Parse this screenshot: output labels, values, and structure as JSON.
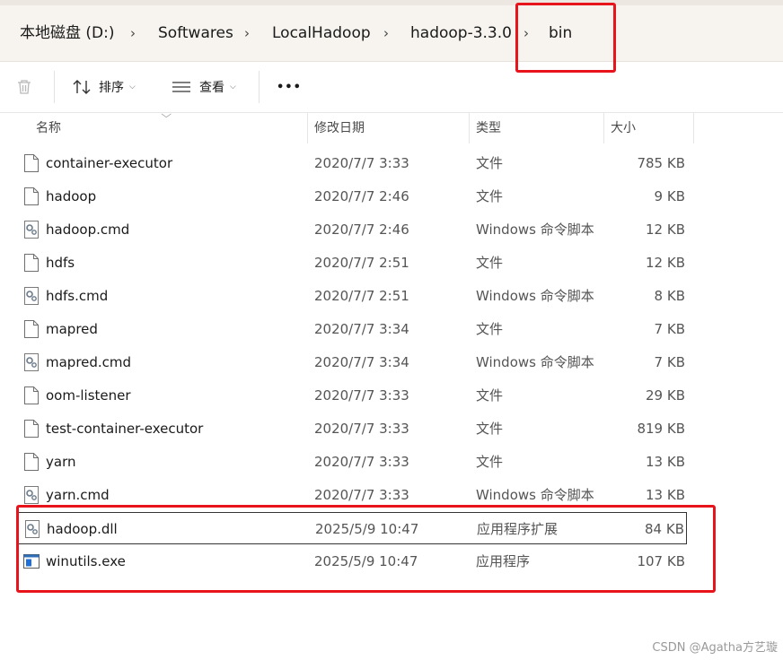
{
  "breadcrumb": {
    "items": [
      "本地磁盘 (D:)",
      "Softwares",
      "LocalHadoop",
      "hadoop-3.3.0",
      "bin"
    ],
    "separator": "›"
  },
  "toolbar": {
    "delete_icon": "trash-icon",
    "sort_label": "排序",
    "view_label": "查看",
    "more_label": "•••"
  },
  "columns": {
    "name": "名称",
    "date": "修改日期",
    "type": "类型",
    "size": "大小"
  },
  "files": [
    {
      "name": "container-executor",
      "date": "2020/7/7 3:33",
      "type": "文件",
      "size": "785 KB",
      "icon": "file-icon"
    },
    {
      "name": "hadoop",
      "date": "2020/7/7 2:46",
      "type": "文件",
      "size": "9 KB",
      "icon": "file-icon"
    },
    {
      "name": "hadoop.cmd",
      "date": "2020/7/7 2:46",
      "type": "Windows 命令脚本",
      "size": "12 KB",
      "icon": "gear-file-icon"
    },
    {
      "name": "hdfs",
      "date": "2020/7/7 2:51",
      "type": "文件",
      "size": "12 KB",
      "icon": "file-icon"
    },
    {
      "name": "hdfs.cmd",
      "date": "2020/7/7 2:51",
      "type": "Windows 命令脚本",
      "size": "8 KB",
      "icon": "gear-file-icon"
    },
    {
      "name": "mapred",
      "date": "2020/7/7 3:34",
      "type": "文件",
      "size": "7 KB",
      "icon": "file-icon"
    },
    {
      "name": "mapred.cmd",
      "date": "2020/7/7 3:34",
      "type": "Windows 命令脚本",
      "size": "7 KB",
      "icon": "gear-file-icon"
    },
    {
      "name": "oom-listener",
      "date": "2020/7/7 3:33",
      "type": "文件",
      "size": "29 KB",
      "icon": "file-icon"
    },
    {
      "name": "test-container-executor",
      "date": "2020/7/7 3:33",
      "type": "文件",
      "size": "819 KB",
      "icon": "file-icon"
    },
    {
      "name": "yarn",
      "date": "2020/7/7 3:33",
      "type": "文件",
      "size": "13 KB",
      "icon": "file-icon"
    },
    {
      "name": "yarn.cmd",
      "date": "2020/7/7 3:33",
      "type": "Windows 命令脚本",
      "size": "13 KB",
      "icon": "gear-file-icon"
    },
    {
      "name": "hadoop.dll",
      "date": "2025/5/9 10:47",
      "type": "应用程序扩展",
      "size": "84 KB",
      "icon": "gear-file-icon"
    },
    {
      "name": "winutils.exe",
      "date": "2025/5/9 10:47",
      "type": "应用程序",
      "size": "107 KB",
      "icon": "app-window-icon"
    }
  ],
  "watermark": "CSDN @Agatha方艺璇",
  "colors": {
    "annotation": "#e8141c",
    "accent": "#1e6fd9"
  }
}
